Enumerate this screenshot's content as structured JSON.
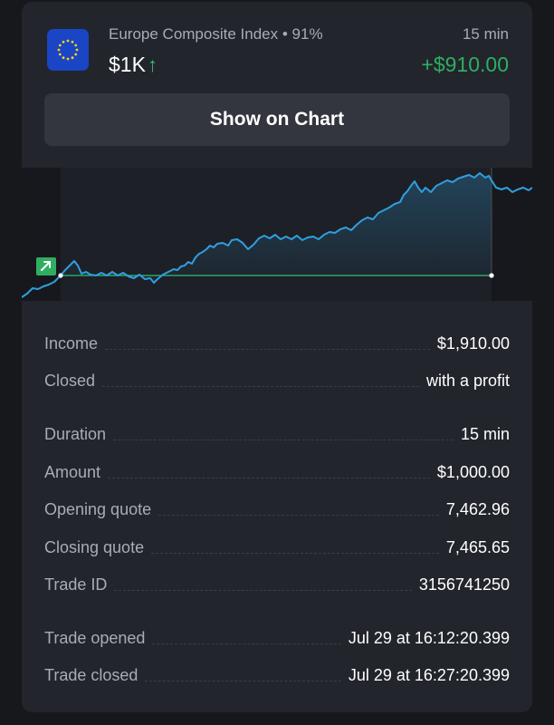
{
  "header": {
    "asset_name": "Europe Composite Index",
    "separator": "•",
    "payout": "91%",
    "duration": "15 min",
    "amount": "$1K",
    "direction_arrow": "↑",
    "direction_icon": "arrow-up-icon",
    "profit": "+$910.00",
    "flag_icon": "eu-flag-icon"
  },
  "show_chart_button": {
    "label": "Show on Chart"
  },
  "chart": {
    "marker_icon": "arrow-up-right-icon",
    "line_color": "#2f9fe0",
    "entry_line_color": "#2fbf71"
  },
  "details": {
    "income": {
      "label": "Income",
      "value": "$1,910.00"
    },
    "closed": {
      "label": "Closed",
      "value": "with a profit"
    },
    "duration": {
      "label": "Duration",
      "value": "15 min"
    },
    "amount": {
      "label": "Amount",
      "value": "$1,000.00"
    },
    "opening_quote": {
      "label": "Opening quote",
      "value": "7,462.96"
    },
    "closing_quote": {
      "label": "Closing quote",
      "value": "7,465.65"
    },
    "trade_id": {
      "label": "Trade ID",
      "value": "3156741250"
    },
    "trade_opened": {
      "label": "Trade opened",
      "value": "Jul 29 at 16:12:20.399"
    },
    "trade_closed": {
      "label": "Trade closed",
      "value": "Jul 29 at 16:27:20.399"
    }
  },
  "colors": {
    "card_bg": "#22252c",
    "profit_green": "#2fae62",
    "button_bg": "#33363e",
    "eu_blue": "#1a45c4",
    "eu_star": "#f7d21c"
  }
}
